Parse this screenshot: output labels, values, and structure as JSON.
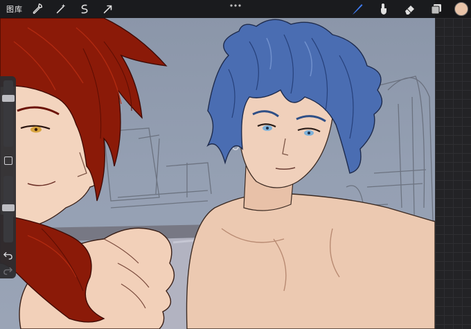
{
  "toolbar": {
    "gallery_label": "图库",
    "left_tools": [
      "wrench-icon",
      "magic-wand-icon",
      "selection-icon",
      "transform-arrow-icon"
    ],
    "right_tools": [
      "brush-icon",
      "smudge-icon",
      "eraser-icon",
      "layers-icon"
    ],
    "active_tool": "brush-icon",
    "accent_color": "#3f7cf2",
    "current_color": "#e8c3a8"
  },
  "sidebar": {
    "brush_size_level": 0.24,
    "opacity_level": 0.48,
    "icons": [
      "modify-button",
      "undo-icon",
      "redo-icon"
    ]
  },
  "colors": {
    "canvas_bg": "#8f9aad",
    "red_hair": "#8b1a08",
    "blue_hair": "#3f62a8",
    "skin": "#ecc9b1"
  }
}
